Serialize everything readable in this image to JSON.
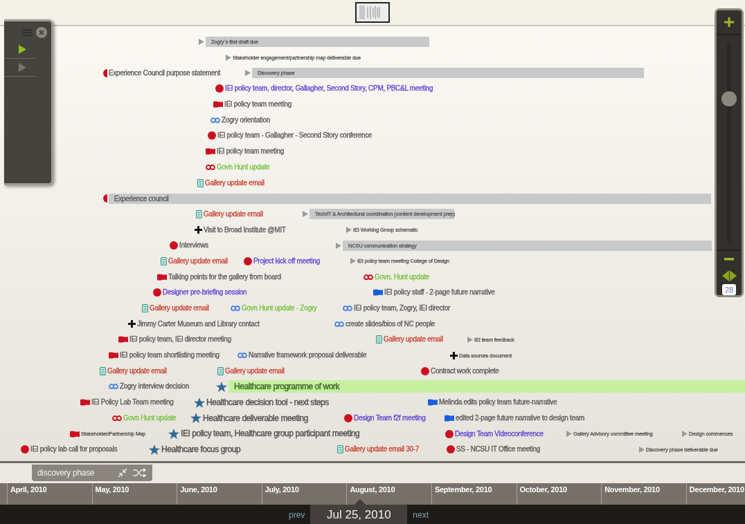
{
  "player": {
    "buttons": [
      {
        "active": true
      },
      {
        "active": false
      }
    ]
  },
  "rows": [
    {
      "events": [
        {
          "kind": "arrow",
          "label": "Zogry`s first draft due",
          "color": "#555555",
          "minor": true,
          "span": true
        }
      ]
    },
    {
      "events": [
        {
          "kind": "arrow",
          "label": "Stakeholder engagement/partnership map deliverable due",
          "color": "#555555",
          "minor": true,
          "span": false
        }
      ]
    },
    {
      "events": [
        {
          "kind": "half",
          "label": "Experience Council purpose statement",
          "color": "#555555",
          "minor": false,
          "span": false
        },
        {
          "kind": "arrow",
          "label": "Discovery phase",
          "color": "#555555",
          "minor": true,
          "span": true
        }
      ]
    },
    {
      "events": [
        {
          "kind": "circle",
          "label": "IEI policy team, director, Gallagher, Second Story, CPM, PBC&L meeting",
          "color": "#5b3fd0",
          "minor": false,
          "span": false
        }
      ]
    },
    {
      "events": [
        {
          "kind": "flag",
          "icon": {
            "color": "#cc1020"
          },
          "label": "IEI policy team meeting",
          "color": "#555555",
          "minor": false,
          "span": false
        }
      ]
    },
    {
      "events": [
        {
          "kind": "loop",
          "icon": {
            "color": "#4f86e0"
          },
          "label": "Zogry orientation",
          "color": "#555555",
          "minor": false,
          "span": false
        }
      ]
    },
    {
      "events": [
        {
          "kind": "circle",
          "label": "IEI policy team - Gallagher - Second Story conference",
          "color": "#555555",
          "minor": false,
          "span": false
        }
      ]
    },
    {
      "events": [
        {
          "kind": "flag",
          "icon": {
            "color": "#cc1020"
          },
          "label": "IEI policy team meeting",
          "color": "#555555",
          "minor": false,
          "span": false
        }
      ]
    },
    {
      "events": [
        {
          "kind": "loop",
          "icon": {
            "color": "#cc1020"
          },
          "label": "Govn Hunt update",
          "color": "#74c23c",
          "minor": false,
          "span": false
        }
      ]
    },
    {
      "events": [
        {
          "kind": "doc",
          "label": "Gallery update email",
          "color": "#c8402f",
          "minor": false,
          "span": false
        }
      ]
    },
    {
      "events": [
        {
          "kind": "half",
          "label": "Experience council",
          "color": "#555555",
          "minor": false,
          "span": true
        }
      ]
    },
    {
      "events": [
        {
          "kind": "doc",
          "label": "Gallery update email",
          "color": "#c8402f",
          "minor": false,
          "span": false
        },
        {
          "kind": "arrow",
          "label": "Tech/IT & Architectural coordination (content development prep)",
          "color": "#555555",
          "minor": true,
          "span": true
        }
      ]
    },
    {
      "events": [
        {
          "kind": "cross",
          "label": "Visit to Broad Institute @MIT",
          "color": "#555555",
          "minor": false,
          "span": false
        },
        {
          "kind": "arrow",
          "label": "IEI Working Group schematic",
          "color": "#555555",
          "minor": true,
          "span": false
        }
      ]
    },
    {
      "events": [
        {
          "kind": "circle",
          "label": "Interviews",
          "color": "#555555",
          "minor": false,
          "span": false
        },
        {
          "kind": "arrow",
          "label": "NCSU communication strategy",
          "color": "#555555",
          "minor": true,
          "span": true
        }
      ]
    },
    {
      "events": [
        {
          "kind": "doc",
          "label": "Gallery update email",
          "color": "#c8402f",
          "minor": false,
          "span": false
        },
        {
          "kind": "circle",
          "label": "Project kick off meeting",
          "color": "#5b3fd0",
          "minor": false,
          "span": false
        },
        {
          "kind": "arrow",
          "label": "IEI policy team meeting College of Design",
          "color": "#555555",
          "minor": true,
          "span": false
        }
      ]
    },
    {
      "events": [
        {
          "kind": "flag",
          "icon": {
            "color": "#cc1020"
          },
          "label": "Talking points for the gallery from board",
          "color": "#555555",
          "minor": false,
          "span": false
        },
        {
          "kind": "loop",
          "icon": {
            "color": "#cc1020"
          },
          "label": "Govn. Hunt update",
          "color": "#74c23c",
          "minor": false,
          "span": false
        }
      ]
    },
    {
      "events": [
        {
          "kind": "circle",
          "label": "Designer pre-briefing session",
          "color": "#5b3fd0",
          "minor": false,
          "span": false
        },
        {
          "kind": "flag",
          "icon": {
            "color": "#1a5fe0"
          },
          "label": "IEI policy staff - 2-page future narrative",
          "color": "#555555",
          "minor": false,
          "span": false
        }
      ]
    },
    {
      "events": [
        {
          "kind": "doc",
          "label": "Gallery update email",
          "color": "#c8402f",
          "minor": false,
          "span": false
        },
        {
          "kind": "loop",
          "icon": {
            "color": "#4f86e0"
          },
          "label": "Govn Hunt update - Zogry",
          "color": "#74c23c",
          "minor": false,
          "span": false
        },
        {
          "kind": "loop",
          "icon": {
            "color": "#4f86e0"
          },
          "label": "IEI policy team, Zogry, IEI director",
          "color": "#555555",
          "minor": false,
          "span": false
        }
      ]
    },
    {
      "events": [
        {
          "kind": "cross",
          "label": "Jimmy Carter Museum and Library contact",
          "color": "#555555",
          "minor": false,
          "span": false
        },
        {
          "kind": "loop",
          "icon": {
            "color": "#4f86e0"
          },
          "label": "create slides/bios of NC people",
          "color": "#555555",
          "minor": false,
          "span": false
        }
      ]
    },
    {
      "events": [
        {
          "kind": "flag",
          "icon": {
            "color": "#cc1020"
          },
          "label": "IEI policy team, IEI director meeting",
          "color": "#555555",
          "minor": false,
          "span": false
        },
        {
          "kind": "doc",
          "label": "Gallery update email",
          "color": "#c8402f",
          "minor": false,
          "span": false
        },
        {
          "kind": "arrow",
          "label": "IEI team feedback",
          "color": "#555555",
          "minor": true,
          "span": false
        }
      ]
    },
    {
      "events": [
        {
          "kind": "flag",
          "icon": {
            "color": "#cc1020"
          },
          "label": "IEI policy team shortlisting meeting",
          "color": "#555555",
          "minor": false,
          "span": false
        },
        {
          "kind": "loop",
          "icon": {
            "color": "#4f86e0"
          },
          "label": "Narrative framework proposal deliverable",
          "color": "#555555",
          "minor": false,
          "span": false
        },
        {
          "kind": "cross",
          "label": "Data sources document",
          "color": "#555555",
          "minor": true,
          "span": false
        }
      ]
    },
    {
      "events": [
        {
          "kind": "doc",
          "label": "Gallery update email",
          "color": "#c8402f",
          "minor": false,
          "span": false
        },
        {
          "kind": "doc",
          "label": "Gallery update email",
          "color": "#c8402f",
          "minor": false,
          "span": false
        },
        {
          "kind": "circle",
          "label": "Contract work complete",
          "color": "#555555",
          "minor": false,
          "span": false
        }
      ]
    },
    {
      "events": [
        {
          "kind": "loop",
          "icon": {
            "color": "#4f86e0"
          },
          "label": "Zogry interview decision",
          "color": "#555555",
          "minor": false,
          "span": false
        },
        {
          "kind": "star",
          "label": "Healthcare programme of work",
          "color": "#3d6b2a",
          "minor": false,
          "span": true
        }
      ]
    },
    {
      "events": [
        {
          "kind": "flag",
          "icon": {
            "color": "#cc1020"
          },
          "label": "IEI Policy Lab Team meeting",
          "color": "#555555",
          "minor": false,
          "span": false
        },
        {
          "kind": "star",
          "label": "Healthcare decision tool - next steps",
          "color": "#555555",
          "minor": false,
          "span": false
        },
        {
          "kind": "flag",
          "icon": {
            "color": "#1a5fe0"
          },
          "label": "Melinda edits policy team future-narrative",
          "color": "#555555",
          "minor": false,
          "span": false
        }
      ]
    },
    {
      "events": [
        {
          "kind": "loop",
          "icon": {
            "color": "#cc1020"
          },
          "label": "Govn Hunt update",
          "color": "#74c23c",
          "minor": false,
          "span": false
        },
        {
          "kind": "star",
          "label": "Healthcare deliverable meeting",
          "color": "#555555",
          "minor": false,
          "span": false
        },
        {
          "kind": "circle",
          "label": "Design Team f2f meeting",
          "color": "#5b3fd0",
          "minor": false,
          "span": false
        },
        {
          "kind": "flag",
          "icon": {
            "color": "#1a5fe0"
          },
          "label": "edited 2-page future narrative to design team",
          "color": "#555555",
          "minor": false,
          "span": false
        }
      ]
    },
    {
      "events": [
        {
          "kind": "flag",
          "icon": {
            "color": "#cc1020"
          },
          "label": "Stakeholder/Partnership Map",
          "color": "#555555",
          "minor": true,
          "span": false
        },
        {
          "kind": "star",
          "label": "IEI policy team, Healthcare group participant meeting",
          "color": "#555555",
          "minor": false,
          "span": false
        },
        {
          "kind": "circle",
          "label": "Design Team Videoconference",
          "color": "#5b3fd0",
          "minor": false,
          "span": false
        },
        {
          "kind": "arrow",
          "label": "Gallery Advisory committee meeting",
          "color": "#555555",
          "minor": true,
          "span": false
        },
        {
          "kind": "arrow",
          "label": "Design commences",
          "color": "#555555",
          "minor": true,
          "span": false
        }
      ]
    },
    {
      "events": [
        {
          "kind": "circle",
          "label": "IEI policy lab call for proposals",
          "color": "#555555",
          "minor": false,
          "span": false
        },
        {
          "kind": "star",
          "label": "Healthcare focus group",
          "color": "#555555",
          "minor": false,
          "span": false
        },
        {
          "kind": "doc",
          "label": "Gallery update email 30-7",
          "color": "#c8402f",
          "minor": false,
          "span": false
        },
        {
          "kind": "circle",
          "label": "SS - NCSU IT Office meeting",
          "color": "#555555",
          "minor": false,
          "span": false
        },
        {
          "kind": "arrow",
          "label": "Discovery phase deliverable due",
          "color": "#555555",
          "minor": true,
          "span": false
        }
      ]
    }
  ],
  "zoom": {
    "level": 0.74,
    "value": "28"
  },
  "band": {
    "label": "discovery phase"
  },
  "months": [
    "April, 2010",
    "May, 2010",
    "June, 2010",
    "July, 2010",
    "August, 2010",
    "September, 2010",
    "October, 2010",
    "November, 2010",
    "December, 2010"
  ],
  "nav": {
    "prev": "prev",
    "date": "Jul 25, 2010",
    "next": "next"
  }
}
